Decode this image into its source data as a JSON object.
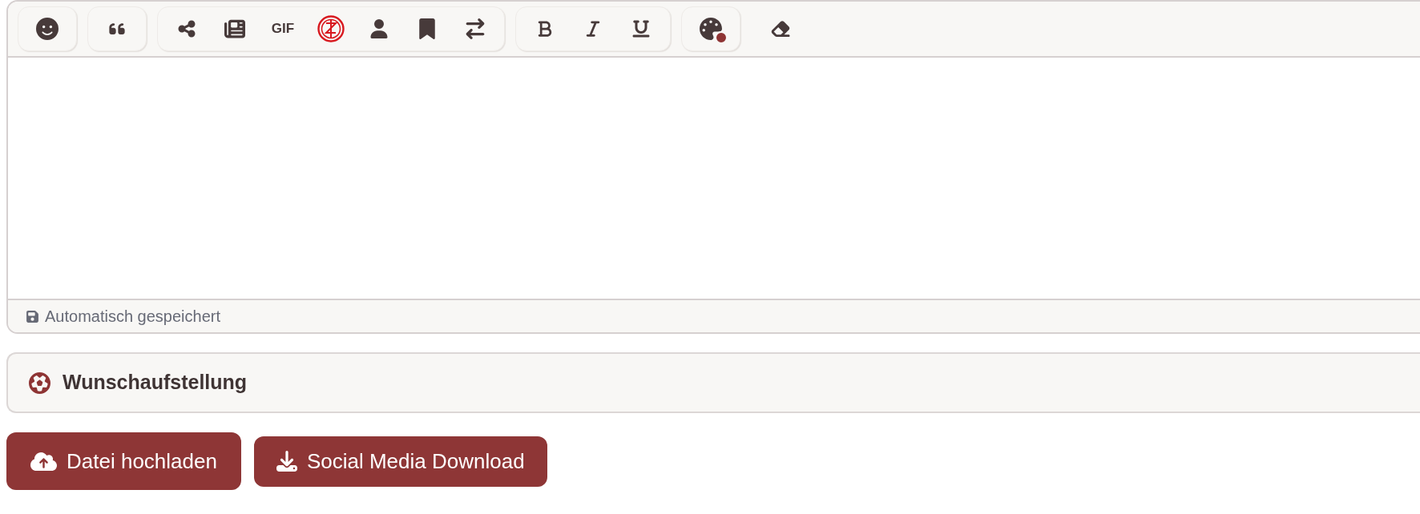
{
  "toolbar": {
    "groups": [
      {
        "framed": true,
        "items": [
          {
            "kind": "emoji"
          }
        ]
      },
      {
        "framed": true,
        "items": [
          {
            "kind": "quote"
          }
        ]
      },
      {
        "framed": true,
        "items": [
          {
            "kind": "share"
          },
          {
            "kind": "news"
          },
          {
            "kind": "text",
            "label": "GIF"
          },
          {
            "kind": "crest"
          },
          {
            "kind": "user"
          },
          {
            "kind": "bookmark"
          },
          {
            "kind": "swap"
          }
        ]
      },
      {
        "framed": true,
        "items": [
          {
            "kind": "bold"
          },
          {
            "kind": "italic"
          },
          {
            "kind": "underline"
          }
        ]
      },
      {
        "framed": true,
        "items": [
          {
            "kind": "palette",
            "color": "#8e3434"
          }
        ]
      },
      {
        "framed": false,
        "items": [
          {
            "kind": "eraser"
          }
        ]
      }
    ]
  },
  "editor": {
    "status": "Automatisch gespeichert"
  },
  "section": {
    "title": "Wunschaufstellung"
  },
  "buttons": [
    {
      "kind": "upload",
      "label": "Datei hochladen"
    },
    {
      "kind": "download",
      "label": "Social Media Download"
    }
  ]
}
